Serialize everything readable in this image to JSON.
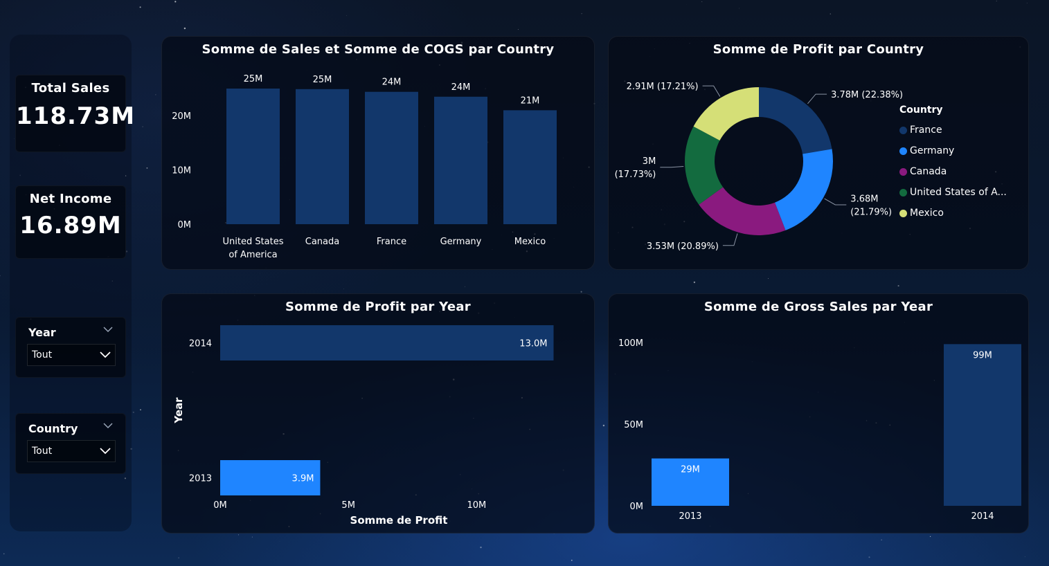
{
  "kpis": {
    "total_sales": {
      "label": "Total Sales",
      "value": "118.73M"
    },
    "net_income": {
      "label": "Net Income",
      "value": "16.89M"
    }
  },
  "slicers": {
    "year": {
      "label": "Year",
      "value": "Tout"
    },
    "country": {
      "label": "Country",
      "value": "Tout"
    }
  },
  "colors": {
    "dark_blue": "#12376b",
    "bright_blue": "#1f85ff",
    "purple": "#8a1a7f",
    "green": "#136b3f",
    "yellow_green": "#d5df77"
  },
  "chart_data": [
    {
      "id": "sales_cogs_by_country",
      "type": "bar",
      "title": "Somme de Sales et Somme de COGS par Country",
      "categories": [
        "United States of America",
        "Canada",
        "France",
        "Germany",
        "Mexico"
      ],
      "category_lines": [
        [
          "United States",
          "of America"
        ],
        [
          "Canada"
        ],
        [
          "France"
        ],
        [
          "Germany"
        ],
        [
          "Mexico"
        ]
      ],
      "values": [
        25.0,
        24.9,
        24.4,
        23.5,
        21.0
      ],
      "data_labels": [
        "25M",
        "25M",
        "24M",
        "24M",
        "21M"
      ],
      "ylim": [
        0,
        25
      ],
      "yticks": [
        {
          "v": 0,
          "label": "0M"
        },
        {
          "v": 10,
          "label": "10M"
        },
        {
          "v": 20,
          "label": "20M"
        }
      ]
    },
    {
      "id": "profit_by_country",
      "type": "pie",
      "title": "Somme de Profit par Country",
      "legend_title": "Country",
      "legend_items": [
        "France",
        "Germany",
        "Canada",
        "United States of A...",
        "Mexico"
      ],
      "slices": [
        {
          "name": "France",
          "value": 3.78,
          "label": [
            "3.78M (22.38%)"
          ],
          "color": "#12376b"
        },
        {
          "name": "Germany",
          "value": 3.68,
          "label": [
            "3.68M",
            "(21.79%)"
          ],
          "color": "#1f85ff"
        },
        {
          "name": "Canada",
          "value": 3.53,
          "label": [
            "3.53M (20.89%)"
          ],
          "color": "#8a1a7f"
        },
        {
          "name": "United States of America",
          "value": 3.0,
          "label": [
            "3M",
            "(17.73%)"
          ],
          "color": "#136b3f"
        },
        {
          "name": "Mexico",
          "value": 2.91,
          "label": [
            "2.91M (17.21%)"
          ],
          "color": "#d5df77"
        }
      ]
    },
    {
      "id": "profit_by_year",
      "type": "bar",
      "orientation": "horizontal",
      "title": "Somme de Profit par Year",
      "xlabel": "Somme de Profit",
      "ylabel": "Year",
      "categories": [
        "2014",
        "2013"
      ],
      "values": [
        13.0,
        3.9
      ],
      "data_labels": [
        "13.0M",
        "3.9M"
      ],
      "xlim": [
        0,
        13.5
      ],
      "xticks": [
        {
          "v": 0,
          "label": "0M"
        },
        {
          "v": 5,
          "label": "5M"
        },
        {
          "v": 10,
          "label": "10M"
        }
      ]
    },
    {
      "id": "gross_sales_by_year",
      "type": "bar",
      "title": "Somme de Gross Sales par Year",
      "categories": [
        "2013",
        "2014"
      ],
      "values": [
        29,
        99
      ],
      "data_labels": [
        "29M",
        "99M"
      ],
      "ylim": [
        0,
        100
      ],
      "yticks": [
        {
          "v": 0,
          "label": "0M"
        },
        {
          "v": 50,
          "label": "50M"
        },
        {
          "v": 100,
          "label": "100M"
        }
      ]
    }
  ]
}
